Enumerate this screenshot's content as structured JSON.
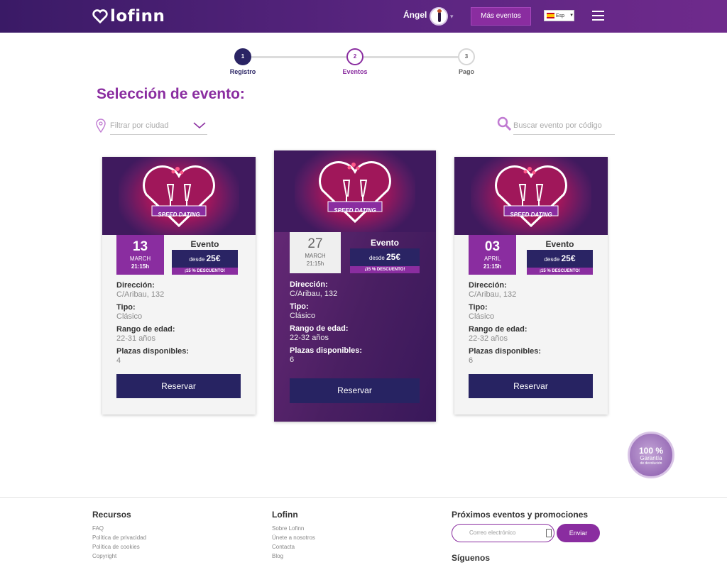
{
  "header": {
    "logo_text": "lofinn",
    "user_name": "Ángel",
    "more_events_label": "Más eventos",
    "language_label": "Esp"
  },
  "steps": [
    {
      "number": "1",
      "label": "Registro"
    },
    {
      "number": "2",
      "label": "Eventos"
    },
    {
      "number": "3",
      "label": "Pago"
    }
  ],
  "page_title": "Selección de evento:",
  "filters": {
    "city_placeholder": "Filtrar por ciudad",
    "search_placeholder": "Buscar evento por código"
  },
  "events": [
    {
      "image_caption": "SPEED DATING",
      "day": "13",
      "month": "MARCH",
      "time": "21:15h",
      "title": "Evento",
      "price_prefix": "desde",
      "price": "25€",
      "promo": "¡15 % DESCUENTO!",
      "address_label": "Dirección:",
      "address": "C/Aribau, 132",
      "type_label": "Tipo:",
      "type": "Clásico",
      "age_label": "Rango de edad:",
      "age": "22-31 años",
      "seats_label": "Plazas disponibles:",
      "seats": "4",
      "button": "Reservar"
    },
    {
      "image_caption": "SPEED DATING",
      "day": "27",
      "month": "MARCH",
      "time": "21:15h",
      "title": "Evento",
      "price_prefix": "desde",
      "price": "25€",
      "promo": "¡15 % DESCUENTO!",
      "address_label": "Dirección:",
      "address": "C/Aribau, 132",
      "type_label": "Tipo:",
      "type": "Clásico",
      "age_label": "Rango de edad:",
      "age": "22-32 años",
      "seats_label": "Plazas disponibles:",
      "seats": "6",
      "button": "Reservar"
    },
    {
      "image_caption": "SPEED DATING",
      "day": "03",
      "month": "APRIL",
      "time": "21:15h",
      "title": "Evento",
      "price_prefix": "desde",
      "price": "25€",
      "promo": "¡15 % DESCUENTO!",
      "address_label": "Dirección:",
      "address": "C/Aribau, 132",
      "type_label": "Tipo:",
      "type": "Clásico",
      "age_label": "Rango de edad:",
      "age": "22-32 años",
      "seats_label": "Plazas disponibles:",
      "seats": "6",
      "button": "Reservar"
    }
  ],
  "badge": {
    "big": "100 %",
    "sub": "Garantía",
    "tiny": "de devolución"
  },
  "footer": {
    "col1": {
      "title": "Recursos",
      "links": [
        "FAQ",
        "Política de privacidad",
        "Política de cookies",
        "Copyright"
      ]
    },
    "col2": {
      "title": "Lofinn",
      "links": [
        "Sobre Lofinn",
        "Únete a nosotros",
        "Contacta",
        "Blog"
      ]
    },
    "col3": {
      "title": "Próximos eventos y promociones",
      "email_placeholder": "Correo electrónico",
      "send_label": "Enviar",
      "follow_title": "Síguenos"
    }
  },
  "colors": {
    "brand_purple": "#8a2da0",
    "navy": "#272362",
    "header_dark": "#3a1a66"
  }
}
